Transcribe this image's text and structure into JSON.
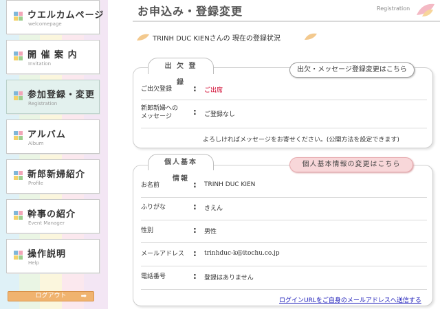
{
  "sidebar": {
    "items": [
      {
        "label": "ウエルカムページ",
        "sub": "welcomepage"
      },
      {
        "label": "開 催 案 内",
        "sub": "Invitation"
      },
      {
        "label": "参加登録・変更",
        "sub": "Registration"
      },
      {
        "label": "アルバム",
        "sub": "Album"
      },
      {
        "label": "新郎新婦紹介",
        "sub": "Profile"
      },
      {
        "label": "幹事の紹介",
        "sub": "Event Manager"
      },
      {
        "label": "操作説明",
        "sub": "Help"
      }
    ],
    "logout_label": "ログアウト",
    "logout_arrow": "➡"
  },
  "header": {
    "title": "お申込み・登録変更",
    "title_en": "Registration"
  },
  "status_line": "TRINH DUC KIENさんの 現在の登録状況",
  "attendance": {
    "tab_label": "出 欠 登 録",
    "change_button": "出欠・メッセージ登録変更はこちら",
    "rows": [
      {
        "label": "ご出欠登録",
        "value": "ご出席"
      },
      {
        "label": "新郎新婦への\nメッセージ",
        "value": "ご登録なし"
      }
    ],
    "note": "よろしければメッセージをお寄せください。(公開方法を設定できます)"
  },
  "personal": {
    "tab_label": "個人基本情報",
    "change_button": "個人基本情報の変更はこちら",
    "rows": [
      {
        "label": "お名前",
        "value": "TRINH DUC KIEN"
      },
      {
        "label": "ふりがな",
        "value": "きえん"
      },
      {
        "label": "性別",
        "value": "男性"
      },
      {
        "label": "メールアドレス",
        "value": "trinhduc-k@itochu.co.jp"
      },
      {
        "label": "電話番号",
        "value": "登録はありません"
      }
    ],
    "send_link": "ログインURLをご自身のメールアドレスへ送信する"
  },
  "colors": {
    "accent_red": "#d0002a",
    "pink_button": "#f8d7d9",
    "link_blue": "#1a1ab8",
    "logout_orange": "#f0b36f"
  }
}
